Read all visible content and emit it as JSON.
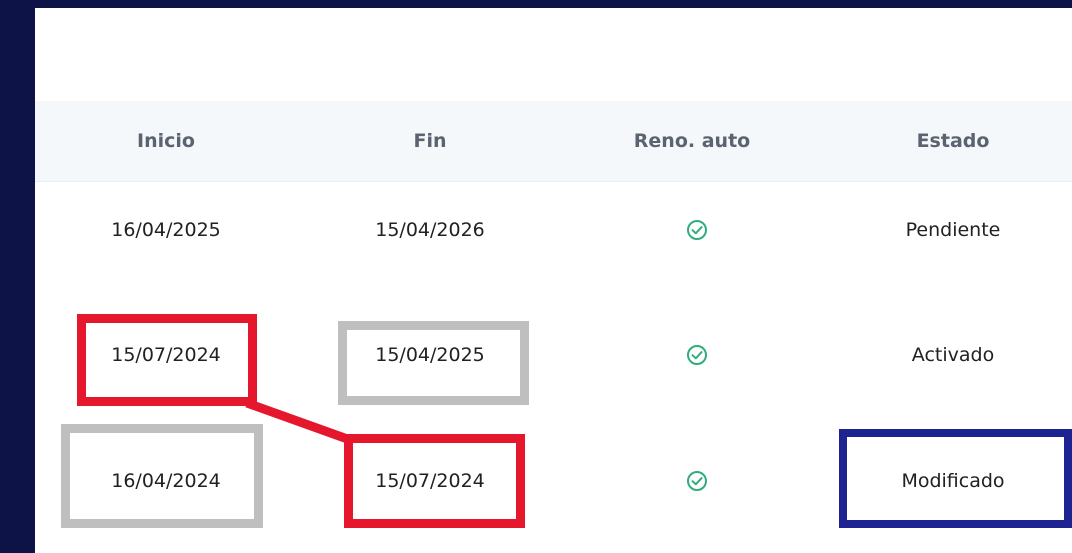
{
  "columns": {
    "inicio": "Inicio",
    "fin": "Fin",
    "reno_auto": "Reno. auto",
    "estado": "Estado"
  },
  "rows": [
    {
      "inicio": "16/04/2025",
      "fin": "15/04/2026",
      "reno_auto_icon": "check-circle-icon",
      "estado": "Pendiente"
    },
    {
      "inicio": "15/07/2024",
      "fin": "15/04/2025",
      "reno_auto_icon": "check-circle-icon",
      "estado": "Activado"
    },
    {
      "inicio": "16/04/2024",
      "fin": "15/07/2024",
      "reno_auto_icon": "check-circle-icon",
      "estado": "Modificado"
    }
  ],
  "colors": {
    "background": "#0d1247",
    "header_bg": "#f5f8fb",
    "check_green": "#2fae7c",
    "highlight_red": "#e5172c",
    "highlight_gray": "#bfbfbf",
    "highlight_blue": "#1d2391"
  }
}
